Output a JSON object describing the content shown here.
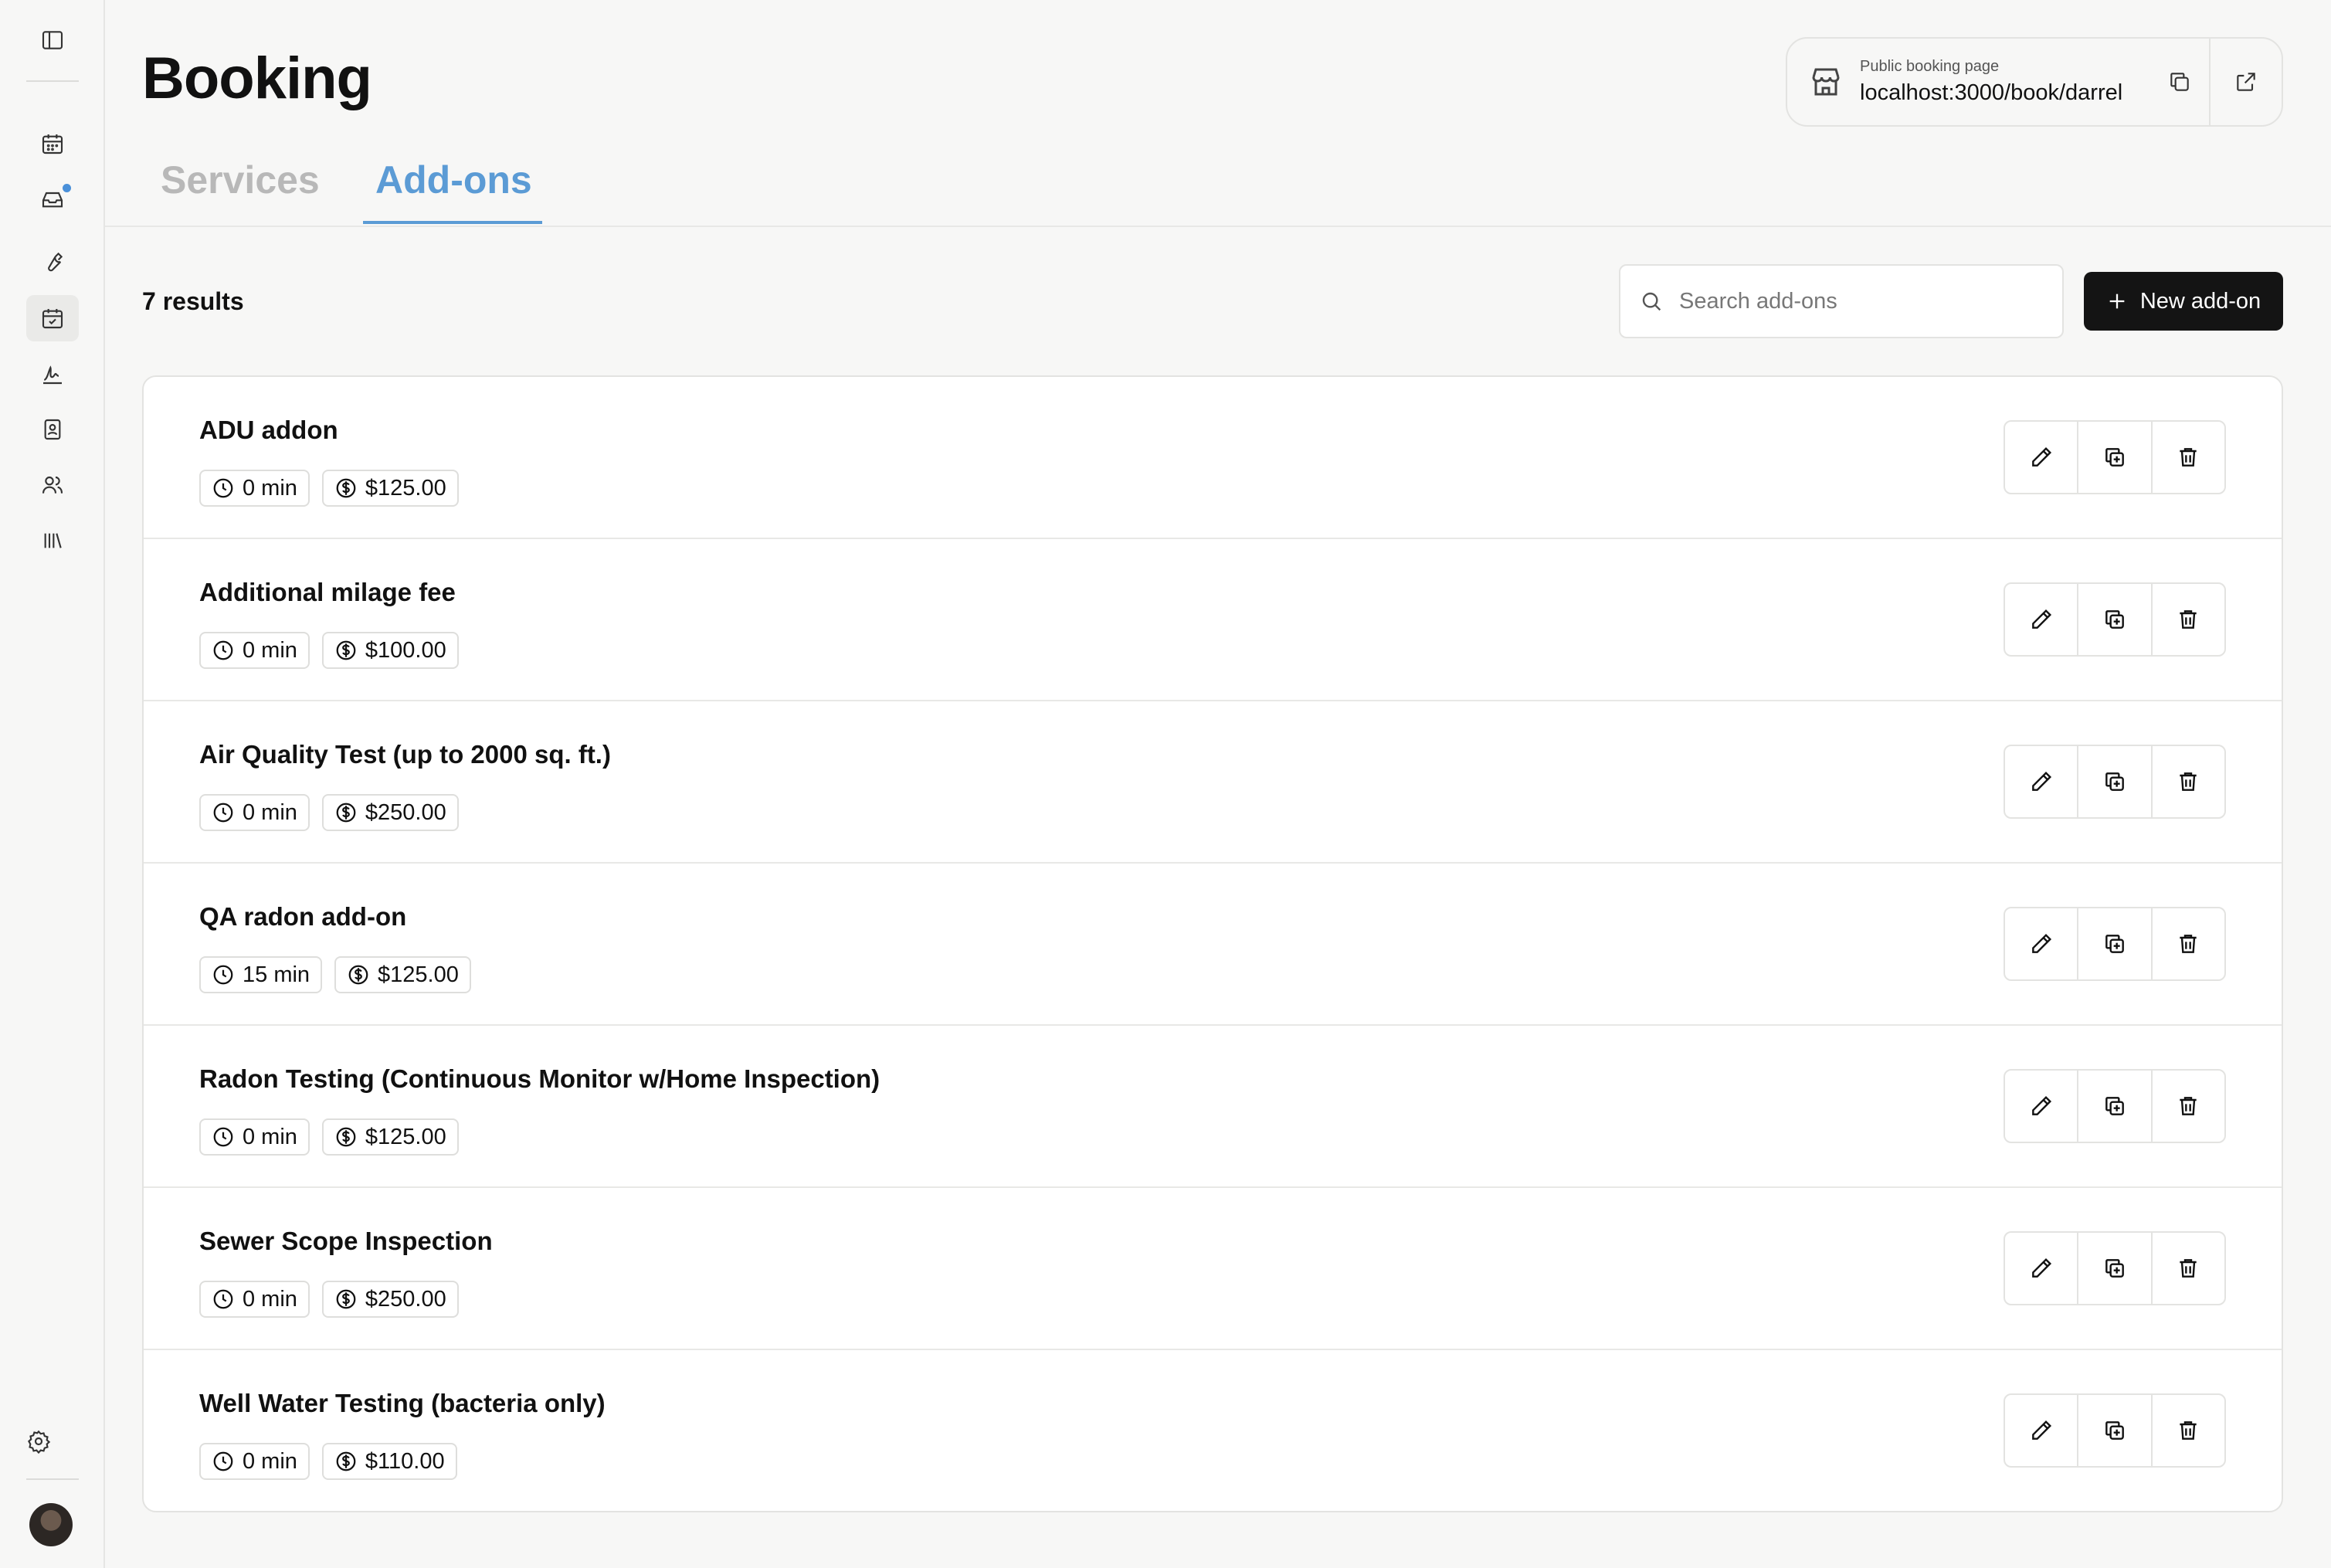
{
  "header": {
    "title": "Booking",
    "public_booking_label": "Public booking page",
    "public_booking_url": "localhost:3000/book/darrel"
  },
  "sidebar": {
    "items": [
      {
        "icon": "sidebar-toggle-icon"
      },
      {
        "icon": "calendar-icon"
      },
      {
        "icon": "inbox-icon",
        "notification": true
      },
      {
        "icon": "wrench-icon"
      },
      {
        "icon": "calendar-check-icon",
        "active": true
      },
      {
        "icon": "signature-icon"
      },
      {
        "icon": "contacts-book-icon"
      },
      {
        "icon": "users-icon"
      },
      {
        "icon": "library-icon"
      },
      {
        "icon": "gear-icon"
      }
    ],
    "accent_color": "#4a90d9"
  },
  "tabs": [
    {
      "label": "Services",
      "active": false
    },
    {
      "label": "Add-ons",
      "active": true
    }
  ],
  "toolbar": {
    "results": "7 results",
    "search_placeholder": "Search add-ons",
    "new_button": "New add-on"
  },
  "addons": [
    {
      "name": "ADU addon",
      "duration": "0 min",
      "price": "$125.00"
    },
    {
      "name": "Additional milage fee",
      "duration": "0 min",
      "price": "$100.00"
    },
    {
      "name": "Air Quality Test (up to 2000 sq. ft.)",
      "duration": "0 min",
      "price": "$250.00"
    },
    {
      "name": "QA radon add-on",
      "duration": "15 min",
      "price": "$125.00"
    },
    {
      "name": "Radon Testing (Continuous Monitor w/Home Inspection)",
      "duration": "0 min",
      "price": "$125.00"
    },
    {
      "name": "Sewer Scope Inspection",
      "duration": "0 min",
      "price": "$250.00"
    },
    {
      "name": "Well Water Testing (bacteria only)",
      "duration": "0 min",
      "price": "$110.00"
    }
  ],
  "colors": {
    "tab_active": "#5b9bd5",
    "tab_inactive": "#b8b8b8",
    "primary_button": "#141414"
  }
}
